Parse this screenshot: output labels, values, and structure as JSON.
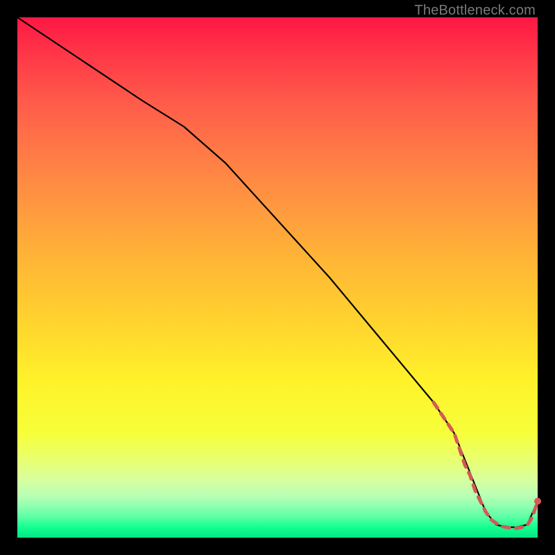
{
  "watermark": "TheBottleneck.com",
  "chart_data": {
    "type": "line",
    "title": "",
    "xlabel": "",
    "ylabel": "",
    "xlim": [
      0,
      100
    ],
    "ylim": [
      0,
      100
    ],
    "series": [
      {
        "name": "black-curve",
        "style": "solid",
        "color": "#000000",
        "x": [
          0,
          12,
          24,
          32,
          40,
          50,
          60,
          70,
          80,
          84,
          86,
          88,
          90,
          92,
          94,
          96,
          98,
          100
        ],
        "y": [
          100,
          92,
          84,
          79,
          72,
          61,
          50,
          38,
          26,
          20,
          15,
          10,
          5,
          2.5,
          2,
          2,
          2.5,
          7
        ]
      },
      {
        "name": "red-dashed-bottom",
        "style": "dashed",
        "color": "#d45a56",
        "dash_width": 5,
        "x": [
          80,
          82,
          84,
          85,
          86,
          87,
          88,
          89,
          90,
          91,
          92,
          93,
          94,
          95,
          96,
          97,
          98,
          99,
          100
        ],
        "y": [
          26,
          23,
          20,
          17,
          14,
          12,
          9,
          7,
          5,
          3.5,
          2.8,
          2.2,
          2.0,
          1.8,
          1.8,
          2.0,
          2.4,
          4,
          7
        ]
      }
    ],
    "markers": [
      {
        "name": "end-point",
        "x": 100,
        "y": 7,
        "color": "#d45a56",
        "r": 5
      }
    ]
  }
}
